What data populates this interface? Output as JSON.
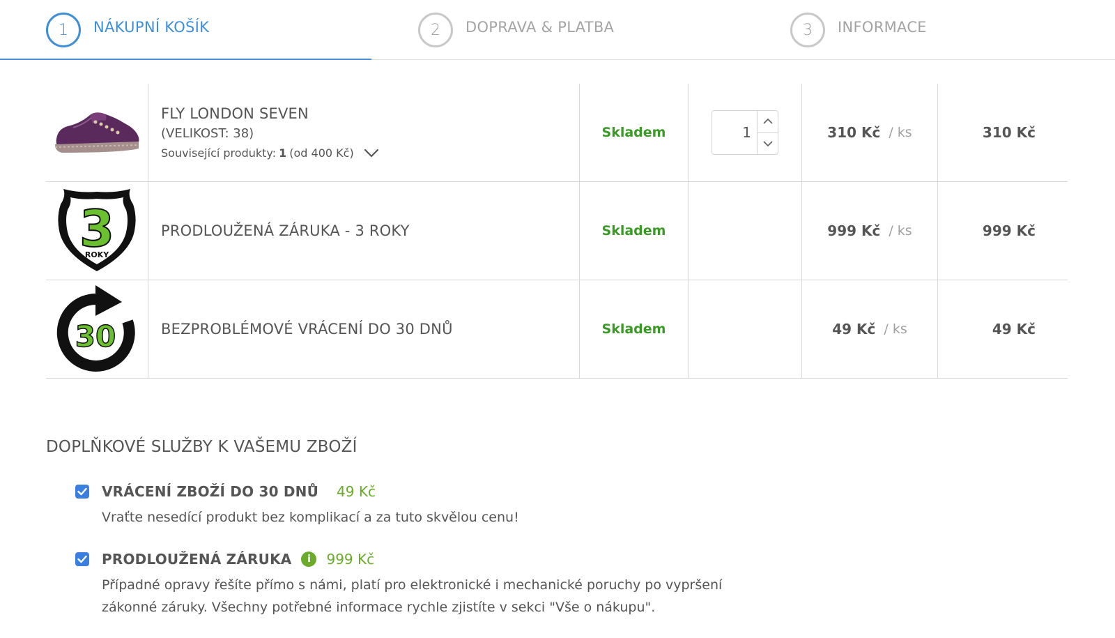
{
  "steps": [
    {
      "number": "1",
      "label": "NÁKUPNÍ KOŠÍK",
      "active": true
    },
    {
      "number": "2",
      "label": "DOPRAVA & PLATBA",
      "active": false
    },
    {
      "number": "3",
      "label": "INFORMACE",
      "active": false
    }
  ],
  "cart": {
    "items": [
      {
        "name": "FLY LONDON SEVEN",
        "variant": "(VELIKOST: 38)",
        "related_label": "Související produkty:",
        "related_count": "1",
        "related_from": "(od 400 Kč)",
        "stock": "Skladem",
        "quantity": "1",
        "unit_price": "310 Kč",
        "unit_suffix": "/ ks",
        "total_price": "310 Kč",
        "image_icon": "shoe-image"
      },
      {
        "name": "PRODLOUŽENÁ ZÁRUKA - 3 ROKY",
        "stock": "Skladem",
        "unit_price": "999 Kč",
        "unit_suffix": "/ ks",
        "total_price": "999 Kč",
        "image_icon": "warranty-3-years-icon",
        "badge_number": "3",
        "badge_text": "ROKY"
      },
      {
        "name": "BEZPROBLÉMOVÉ VRÁCENÍ DO 30 DNŮ",
        "stock": "Skladem",
        "unit_price": "49 Kč",
        "unit_suffix": "/ ks",
        "total_price": "49 Kč",
        "image_icon": "return-30-days-icon",
        "badge_number": "30"
      }
    ]
  },
  "services": {
    "title": "DOPLŇKOVÉ SLUŽBY K VAŠEMU ZBOŽÍ",
    "items": [
      {
        "name": "VRÁCENÍ ZBOŽÍ DO 30 DNŮ",
        "price": "49 Kč",
        "checked": true,
        "description": "Vraťte nesedící produkt bez komplikací a za tuto skvělou cenu!"
      },
      {
        "name": "PRODLOUŽENÁ ZÁRUKA",
        "price": "999 Kč",
        "checked": true,
        "info_icon": "i",
        "description": "Případné opravy řešíte přímo s námi, platí pro elektronické i mechanické poruchy po vypršení zákonné záruky. Všechny potřebné informace rychle zjistíte v sekci \"Vše o nákupu\"."
      }
    ]
  },
  "colors": {
    "accent": "#3f8fd8",
    "stock_green": "#3a9a26",
    "price_green": "#6aab2a",
    "checkbox_blue": "#3a7fe0"
  }
}
